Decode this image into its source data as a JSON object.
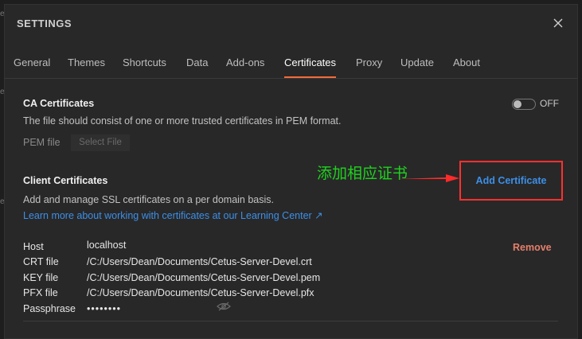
{
  "background": {
    "snippets": [
      "e",
      "e",
      "e"
    ]
  },
  "modal": {
    "title": "SETTINGS",
    "tabs": [
      {
        "label": "General"
      },
      {
        "label": "Themes"
      },
      {
        "label": "Shortcuts"
      },
      {
        "label": "Data"
      },
      {
        "label": "Add-ons"
      },
      {
        "label": "Certificates",
        "active": true
      },
      {
        "label": "Proxy"
      },
      {
        "label": "Update"
      },
      {
        "label": "About"
      }
    ]
  },
  "ca": {
    "title": "CA Certificates",
    "toggle_label": "OFF",
    "description": "The file should consist of one or more trusted certificates in PEM format.",
    "pem_label": "PEM file",
    "select_file": "Select File"
  },
  "client": {
    "title": "Client Certificates",
    "add_button": "Add Certificate",
    "annotation": "添加相应证书",
    "description": "Add and manage SSL certificates on a per domain basis.",
    "link": "Learn more about working with certificates at our Learning Center ↗"
  },
  "cert": {
    "remove": "Remove",
    "rows": [
      {
        "label": "Host",
        "value": "localhost"
      },
      {
        "label": "CRT file",
        "value": "/C:/Users/Dean/Documents/Cetus-Server-Devel.crt"
      },
      {
        "label": "KEY file",
        "value": "/C:/Users/Dean/Documents/Cetus-Server-Devel.pem"
      },
      {
        "label": "PFX file",
        "value": "/C:/Users/Dean/Documents/Cetus-Server-Devel.pfx"
      },
      {
        "label": "Passphrase",
        "value": "••••••••"
      }
    ]
  },
  "colors": {
    "accent_tab": "#f26b3a",
    "link": "#3d8fe8",
    "remove": "#e57f6b",
    "annotation": "#1fd21f",
    "highlight_box": "#ff3030"
  },
  "icons": {
    "close": "close-icon",
    "eye": "eye-slash-icon",
    "arrow": "red-arrow-icon"
  }
}
